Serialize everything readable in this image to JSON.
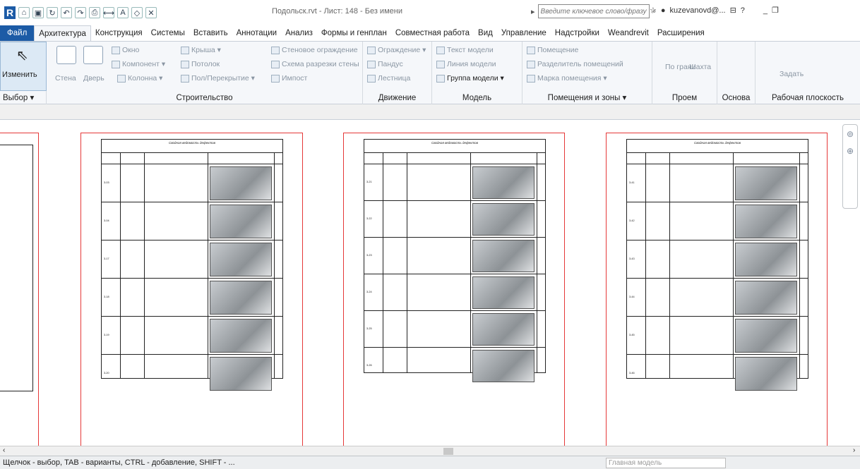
{
  "titlebar": {
    "doc_title": "Подольск.rvt - Лист: 148 - Без имени",
    "search_placeholder": "Введите ключевое слово/фразу",
    "user": "kuzevanovd@..."
  },
  "menu": [
    "Файл",
    "Архитектура",
    "Конструкция",
    "Системы",
    "Вставить",
    "Аннотации",
    "Анализ",
    "Формы и генплан",
    "Совместная работа",
    "Вид",
    "Управление",
    "Надстройки",
    "Weandrevit",
    "Расширения"
  ],
  "ribbon": {
    "modify_label": "Изменить",
    "select_label": "Выбор ▾",
    "build": {
      "label": "Строительство",
      "items": [
        "Стена",
        "Дверь",
        "Окно",
        "Компонент ▾",
        "Колонна ▾",
        "Крыша ▾",
        "Потолок",
        "Пол/Перекрытие ▾",
        "Стеновое ограждение",
        "Схема разрезки стены",
        "Импост"
      ]
    },
    "move": {
      "label": "Движение",
      "items": [
        "Ограждение ▾",
        "Пандус",
        "Лестница"
      ]
    },
    "model": {
      "label": "Модель",
      "items": [
        "Текст модели",
        "Линия модели",
        "Группа модели ▾"
      ]
    },
    "rooms": {
      "label": "Помещения и зоны ▾",
      "items": [
        "Помещение",
        "Разделитель помещений",
        "Марка помещения ▾"
      ]
    },
    "opening": {
      "label": "Проем",
      "items": [
        "По грани",
        "Шахта"
      ]
    },
    "datum": {
      "label": "Основа"
    },
    "workplane": {
      "label": "Рабочая плоскость",
      "items": [
        "Задать"
      ]
    }
  },
  "sheets": [
    {
      "caption": "Сводная ведомость дефектов",
      "rows": [
        "3-03",
        "3-04",
        "3-17",
        "3-18",
        "3-19",
        "3-20"
      ]
    },
    {
      "caption": "Сводная ведомость дефектов",
      "rows": [
        "3-21",
        "3-22",
        "3-23",
        "3-24",
        "3-25",
        "3-26"
      ]
    },
    {
      "caption": "Сводная ведомость дефектов",
      "rows": [
        "3-41",
        "3-42",
        "3-43",
        "3-44",
        "3-45",
        "3-46"
      ]
    }
  ],
  "status": {
    "text": "Щелчок - выбор, TAB - варианты, CTRL - добавление, SHIFT - ...",
    "model_field": "Главная модель"
  }
}
